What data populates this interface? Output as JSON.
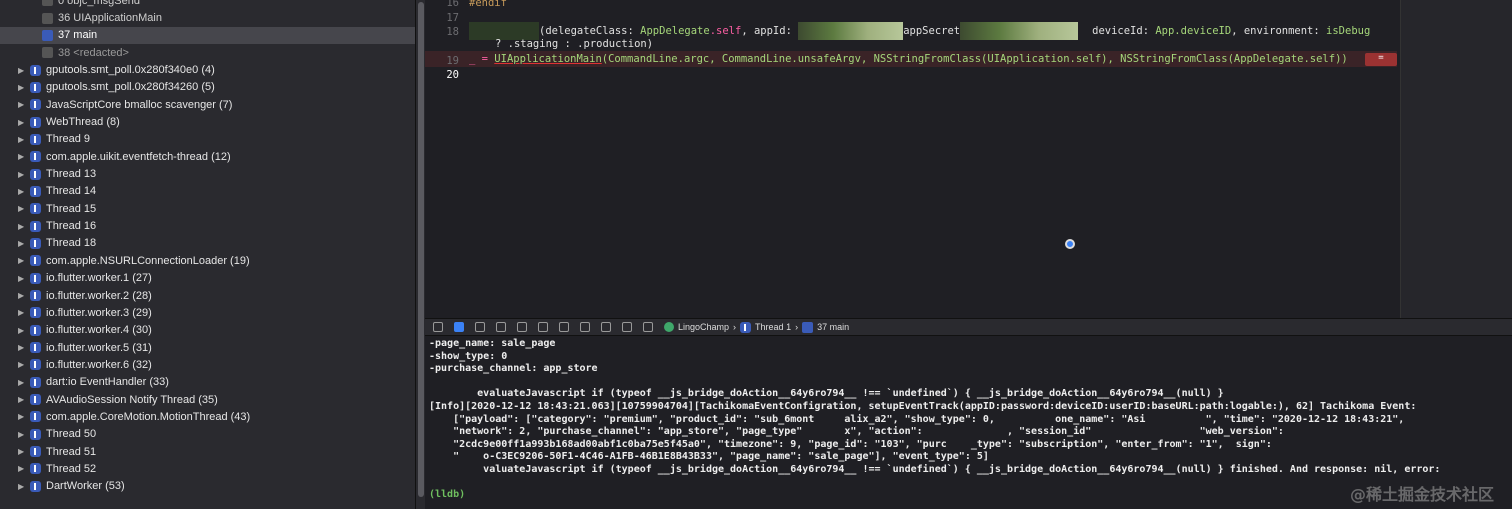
{
  "frames": [
    {
      "label": "0 objc_msgSend",
      "icon": "frame-icon"
    },
    {
      "label": "36 UIApplicationMain",
      "icon": "frame-icon"
    },
    {
      "label": "37 main",
      "icon": "user-frame-icon",
      "selected": true
    },
    {
      "label": "38 <redacted>",
      "icon": "frame-icon"
    }
  ],
  "threads": [
    "gputools.smt_poll.0x280f340e0 (4)",
    "gputools.smt_poll.0x280f34260 (5)",
    "JavaScriptCore bmalloc scavenger (7)",
    "WebThread (8)",
    "Thread 9",
    "com.apple.uikit.eventfetch-thread (12)",
    "Thread 13",
    "Thread 14",
    "Thread 15",
    "Thread 16",
    "Thread 18",
    "com.apple.NSURLConnectionLoader (19)",
    "io.flutter.worker.1 (27)",
    "io.flutter.worker.2 (28)",
    "io.flutter.worker.3 (29)",
    "io.flutter.worker.4 (30)",
    "io.flutter.worker.5 (31)",
    "io.flutter.worker.6 (32)",
    "dart:io EventHandler (33)",
    "AVAudioSession Notify Thread (35)",
    "com.apple.CoreMotion.MotionThread (43)",
    "Thread 50",
    "Thread 51",
    "Thread 52",
    "DartWorker (53)"
  ],
  "editor": {
    "lines": [
      "16",
      "17",
      "18",
      "19",
      "20"
    ],
    "l16": "#endif",
    "l18a": "(delegateClass: ",
    "l18b": "AppDelegate",
    "l18c": ".self",
    "l18d": ", appId: ",
    "l18e": "appSecret",
    "l18f": "deviceId: ",
    "l18g": "App.deviceID",
    "l18h": ", environment: ",
    "l18i": "isDebug",
    "l18cont": "? .staging : .production)",
    "l19a": "_ = ",
    "l19b": "UIApplicationMain",
    "l19c": "(CommandLine.argc, CommandLine.unsafeArgv, NSStringFromClass(UIApplication.self), NSStringFromClass(AppDelegate.self))",
    "err_badge": "="
  },
  "debug_bar": {
    "app": "LingoChamp",
    "thread": "Thread 1",
    "frame": "37 main"
  },
  "console": [
    "-page_name: sale_page",
    "-show_type: 0",
    "-purchase_channel: app_store",
    "",
    "        evaluateJavascript if (typeof __js_bridge_doAction__64y6ro794__ !== `undefined`) { __js_bridge_doAction__64y6ro794__(null) }",
    "[Info][2020-12-12 18:43:21.063][10759904704][TachikomaEventConfigration, setupEventTrack(appID:password:deviceID:userID:baseURL:path:logable:), 62] Tachikoma Event:",
    "    [\"payload\": [\"category\": \"premium\", \"product_id\": \"sub_6mont     alix_a2\", \"show_type\": 0,          one_name\": \"Asi          \", \"time\": \"2020-12-12 18:43:21\",",
    "    \"network\": 2, \"purchase_channel\": \"app_store\", \"page_type\"       x\", \"action\":              , \"session_id\"                  \"web_version\":",
    "    \"2cdc9e00ff1a993b168ad00abf1c0ba75e5f45a0\", \"timezone\": 9, \"page_id\": \"103\", \"purc    _type\": \"subscription\", \"enter_from\": \"1\",  sign\":",
    "    \"    o-C3EC9206-50F1-4C46-A1FB-46B1E8B43B33\", \"page_name\": \"sale_page\"], \"event_type\": 5]",
    "         valuateJavascript if (typeof __js_bridge_doAction__64y6ro794__ !== `undefined`) { __js_bridge_doAction__64y6ro794__(null) } finished. And response: nil, error:"
  ],
  "prompt": "(lldb)",
  "watermark": "@稀土掘金技术社区"
}
